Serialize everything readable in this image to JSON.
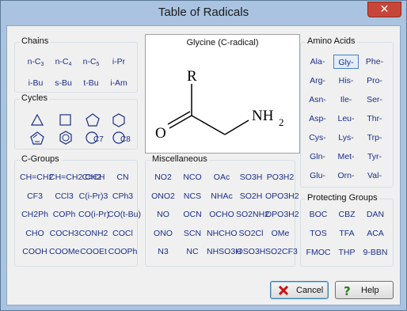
{
  "window": {
    "title": "Table of Radicals",
    "close_label": "✕"
  },
  "preview": {
    "title": "Glycine (C-radical)",
    "formula_r": "R",
    "formula_o": "O",
    "formula_nh": "NH",
    "formula_sub": "2"
  },
  "groups": {
    "chains": "Chains",
    "cycles": "Cycles",
    "cgroups": "C-Groups",
    "misc": "Miscellaneous",
    "amino": "Amino Acids",
    "protecting": "Protecting Groups"
  },
  "chains": [
    [
      "n-C",
      "3"
    ],
    [
      "n-C",
      "4"
    ],
    [
      "n-C",
      "5"
    ],
    [
      "i-Pr",
      ""
    ],
    [
      "i-Bu",
      ""
    ],
    [
      "s-Bu",
      ""
    ],
    [
      "t-Bu",
      ""
    ],
    [
      "i-Am",
      ""
    ]
  ],
  "cycles": [
    "triangle-icon",
    "square-icon",
    "pentagon-icon",
    "hexagon-icon",
    "cyclopentadiene-icon",
    "benzene-icon",
    "c7-ring-icon",
    "c8-ring-icon"
  ],
  "cycle_labels": {
    "c7": "C7",
    "c8": "C8"
  },
  "cgroups": [
    "CH=CH2",
    "CH=CH2 CH2",
    "C≡CH",
    "CN",
    "CF3",
    "CCl3",
    "C(i-Pr)3",
    "CPh3",
    "CH2Ph",
    "COPh",
    "CO(i-Pr)",
    "CO(t-Bu)",
    "CHO",
    "COCH3",
    "CONH2",
    "COCl",
    "COOH",
    "COOMe",
    "COOEt",
    "COOPh"
  ],
  "misc": [
    "NO2",
    "NCO",
    "OAc",
    "SO3H",
    "PO3H2",
    "ONO2",
    "NCS",
    "NHAc",
    "SO2H",
    "OPO3H2",
    "NO",
    "OCN",
    "OCHO",
    "SO2NH2",
    "OPO3H2",
    "ONO",
    "SCN",
    "NHCHO",
    "SO2Cl",
    "OMe",
    "N3",
    "NC",
    "NHSO3H",
    "OSO3H",
    "SO2CF3"
  ],
  "amino": [
    "Ala-",
    "Gly-",
    "Phe-",
    "Arg-",
    "His-",
    "Pro-",
    "Asn-",
    "Ile-",
    "Ser-",
    "Asp-",
    "Leu-",
    "Thr-",
    "Cys-",
    "Lys-",
    "Trp-",
    "Gln-",
    "Met-",
    "Tyr-",
    "Glu-",
    "Orn-",
    "Val-"
  ],
  "selected_amino": "Gly-",
  "protecting": [
    "BOC",
    "CBZ",
    "DAN",
    "TOS",
    "TFA",
    "ACA",
    "FMOC",
    "THP",
    "9-BBN"
  ],
  "buttons": {
    "cancel": "Cancel",
    "help": "Help"
  },
  "colors": {
    "accent_text": "#1a2e8a",
    "window_frame": "#a9c3e0",
    "close_red": "#c7463a"
  }
}
